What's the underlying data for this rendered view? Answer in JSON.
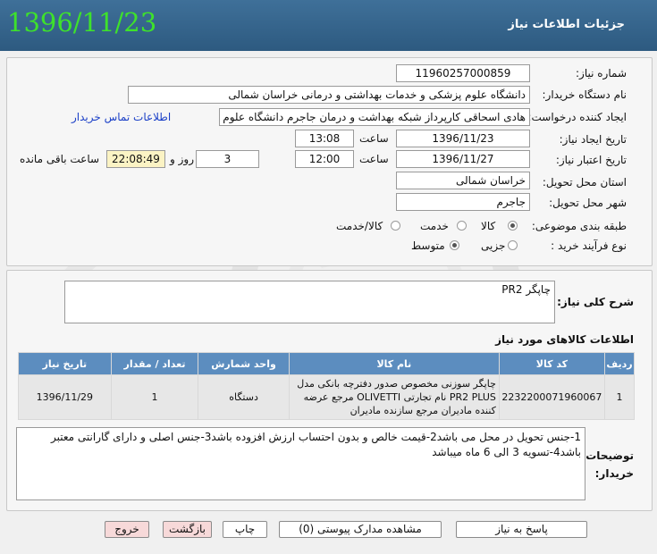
{
  "header": {
    "title": "جزئیات اطلاعات نیاز",
    "date_stamp": "1396/11/23"
  },
  "form": {
    "need_number_label": "شماره نیاز:",
    "need_number": "11960257000859",
    "buyer_label": "نام دستگاه خریدار:",
    "buyer": "دانشگاه علوم پزشکی و خدمات بهداشتی و درمانی خراسان شمالی",
    "requester_label": "ایجاد کننده درخواست:",
    "requester": "هادی اسحاقی کارپرداز  شبکه بهداشت و درمان جاجرم دانشگاه علوم پزشکی و",
    "contact_link": "اطلاعات تماس خریدار",
    "created_label": "تاریخ ایجاد نیاز:",
    "created_date": "1396/11/23",
    "created_time_label": "ساعت",
    "created_time": "13:08",
    "deadline_label": "تاریخ اعتبار نیاز:",
    "deadline_date": "1396/11/27",
    "deadline_time_label": "ساعت",
    "deadline_time": "12:00",
    "days_value": "3",
    "days_label": "روز و",
    "remaining_time": "22:08:49",
    "remaining_label": "ساعت باقی مانده",
    "province_label": "استان محل تحویل:",
    "province": "خراسان شمالی",
    "city_label": "شهر محل تحویل:",
    "city": "جاجرم",
    "category_label": "طبقه بندی موضوعی:",
    "category_options": [
      "کالا",
      "خدمت",
      "کالا/خدمت"
    ],
    "process_label": "نوع فرآیند خرید :",
    "process_options": [
      "جزیی",
      "متوسط"
    ]
  },
  "general": {
    "label": "شرح کلی نیاز:",
    "value": "چاپگر PR2"
  },
  "goods": {
    "title": "اطلاعات کالاهای مورد نیاز",
    "columns": [
      "ردیف",
      "کد کالا",
      "نام کالا",
      "واحد شمارش",
      "تعداد / مقدار",
      "تاریخ نیاز"
    ],
    "rows": [
      {
        "index": "1",
        "code": "2232200071960067",
        "name": "چاپگر سوزنی مخصوص صدور دفترچه بانکی مدل PR2 PLUS نام تجارتی OLIVETTI مرجع عرضه کننده مادیران مرجع سازنده مادیران",
        "unit": "دستگاه",
        "qty": "1",
        "date": "1396/11/29"
      }
    ]
  },
  "notes": {
    "label": "توضیحات خریدار:",
    "text": "1-جنس تحویل در محل می باشد2-قیمت خالص و بدون احتساب ارزش افزوده باشد3-جنس اصلی و دارای گارانتی معتبر باشد4-تسویه 3 الی 6 ماه میباشد"
  },
  "buttons": {
    "reply": "پاسخ به نیاز",
    "docs": "مشاهده مدارک پیوستی (0)",
    "print": "چاپ",
    "back": "بازگشت",
    "exit": "خروج"
  },
  "colors": {
    "header": "#3a6a93",
    "date_green": "#3ee22b",
    "table_header": "#5c8dbf",
    "link": "#1a3fc7",
    "highlight": "#fbf3c4"
  }
}
